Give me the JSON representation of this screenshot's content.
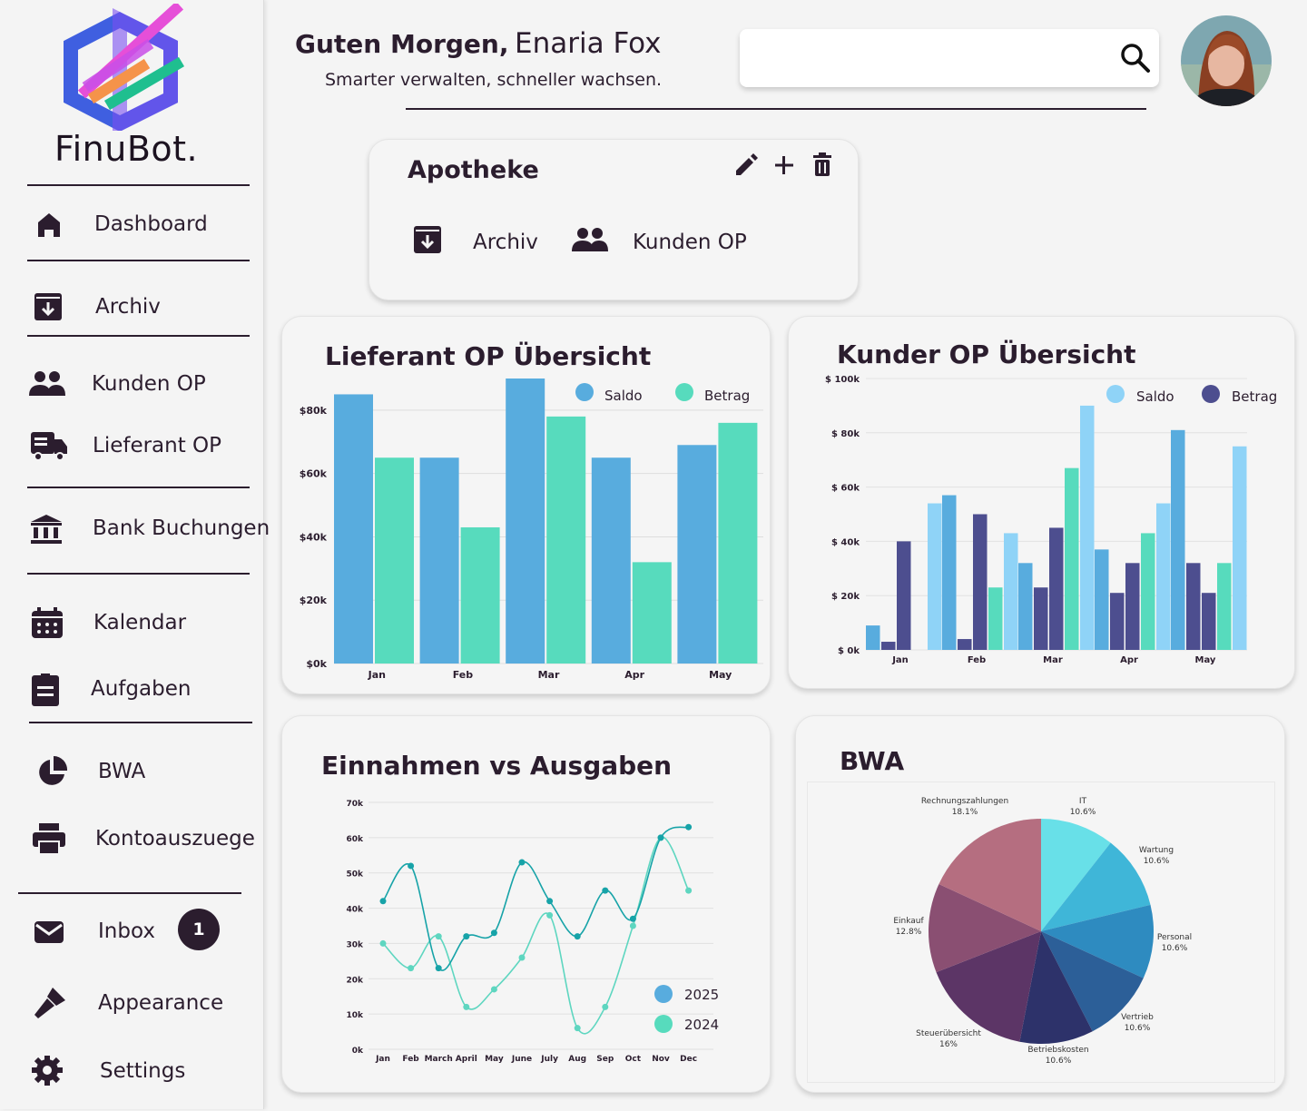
{
  "app": {
    "brand": "FinuBot."
  },
  "sidebar": {
    "items": [
      {
        "label": "Dashboard",
        "icon": "home-icon"
      },
      {
        "label": "Archiv",
        "icon": "archive-icon"
      },
      {
        "label": "Kunden OP",
        "icon": "people-icon"
      },
      {
        "label": "Lieferant OP",
        "icon": "truck-icon"
      },
      {
        "label": "Bank Buchungen",
        "icon": "bank-icon"
      },
      {
        "label": "Kalendar",
        "icon": "calendar-icon"
      },
      {
        "label": "Aufgaben",
        "icon": "task-icon"
      },
      {
        "label": "BWA",
        "icon": "pie-chart-icon"
      },
      {
        "label": "Kontoauszuege",
        "icon": "printer-icon"
      },
      {
        "label": "Inbox",
        "icon": "mail-icon",
        "badge": "1"
      },
      {
        "label": "Appearance",
        "icon": "brush-icon"
      },
      {
        "label": "Settings",
        "icon": "gear-icon"
      }
    ]
  },
  "header": {
    "greeting": "Guten Morgen,",
    "user_name": "Enaria Fox",
    "tagline": "Smarter verwalten, schneller wachsen.",
    "search_value": "",
    "search_icon": "search-icon"
  },
  "apotheke": {
    "title": "Apotheke",
    "actions": [
      "edit-icon",
      "plus-icon",
      "trash-icon"
    ],
    "links": [
      {
        "label": "Archiv",
        "icon": "archive-icon"
      },
      {
        "label": "Kunden OP",
        "icon": "people-icon"
      }
    ]
  },
  "colors": {
    "accent_dark": "#2b1d2e",
    "blue": "#58acde",
    "teal": "#57dbbd",
    "light_blue": "#8fd3f7",
    "navy": "#4d4e8f"
  },
  "chart_data": [
    {
      "type": "bar",
      "title": "Lieferant OP Übersicht",
      "categories": [
        "Jan",
        "Feb",
        "Mar",
        "Apr",
        "May"
      ],
      "series": [
        {
          "name": "Saldo",
          "values": [
            85000,
            65000,
            90000,
            65000,
            69000
          ]
        },
        {
          "name": "Betrag",
          "values": [
            65000,
            43000,
            78000,
            32000,
            76000
          ]
        }
      ],
      "yticks": [
        "$0k",
        "$20k",
        "$40k",
        "$60k",
        "$80k"
      ],
      "ylim": [
        0,
        90000
      ],
      "legend": "top-right",
      "grid": true
    },
    {
      "type": "bar",
      "title": "Kunder OP Übersicht",
      "categories": [
        "Jan",
        "Feb",
        "Mar",
        "Apr",
        "May"
      ],
      "legend_series": [
        "Saldo",
        "Betrag"
      ],
      "groups": [
        [
          9000,
          3000,
          40000,
          0,
          54000
        ],
        [
          57000,
          4000,
          50000,
          23000,
          43000
        ],
        [
          32000,
          23000,
          45000,
          67000,
          90000
        ],
        [
          37000,
          21000,
          32000,
          43000,
          54000
        ],
        [
          81000,
          32000,
          21000,
          32000,
          75000
        ]
      ],
      "bar_colors": [
        "#58acde",
        "#4d4e8f",
        "#4d4e8f",
        "#57dbbd",
        "#8fd3f7"
      ],
      "yticks": [
        "$ 0k",
        "$ 20k",
        "$ 40k",
        "$ 60k",
        "$ 80k",
        "$ 100k"
      ],
      "ylim": [
        0,
        100000
      ],
      "legend": "top-right",
      "grid": true
    },
    {
      "type": "line",
      "title": "Einnahmen vs Ausgaben",
      "categories": [
        "Jan",
        "Feb",
        "March",
        "April",
        "May",
        "June",
        "July",
        "Aug",
        "Sep",
        "Oct",
        "Nov",
        "Dec"
      ],
      "series": [
        {
          "name": "2025",
          "values": [
            42000,
            52000,
            23000,
            32000,
            33000,
            53000,
            42000,
            32000,
            45000,
            37000,
            60000,
            63000
          ]
        },
        {
          "name": "2024",
          "values": [
            30000,
            23000,
            32000,
            12000,
            17000,
            26000,
            38000,
            6000,
            12000,
            35000,
            60000,
            45000
          ]
        }
      ],
      "yticks": [
        "0k",
        "10k",
        "20k",
        "30k",
        "40k",
        "50k",
        "60k",
        "70k"
      ],
      "ylim": [
        0,
        70000
      ],
      "legend": "bottom-right",
      "grid": true
    },
    {
      "type": "pie",
      "title": "BWA",
      "slices": [
        {
          "label": "IT",
          "pct": "10.6%",
          "value": 10.6
        },
        {
          "label": "Wartung",
          "pct": "10.6%",
          "value": 10.6
        },
        {
          "label": "Personal",
          "pct": "10.6%",
          "value": 10.6
        },
        {
          "label": "Vertrieb",
          "pct": "10.6%",
          "value": 10.6
        },
        {
          "label": "Betriebskosten",
          "pct": "10.6%",
          "value": 10.6
        },
        {
          "label": "Steuerübersicht",
          "pct": "16%",
          "value": 16
        },
        {
          "label": "Einkauf",
          "pct": "12.8%",
          "value": 12.8
        },
        {
          "label": "Rechnungszahlungen",
          "pct": "18.1%",
          "value": 18.1
        }
      ],
      "slice_colors": [
        "#68e0e8",
        "#3fb6d8",
        "#2e8bc0",
        "#2c5f98",
        "#2d326a",
        "#5c3566",
        "#8a4f72",
        "#b56e80"
      ]
    }
  ]
}
